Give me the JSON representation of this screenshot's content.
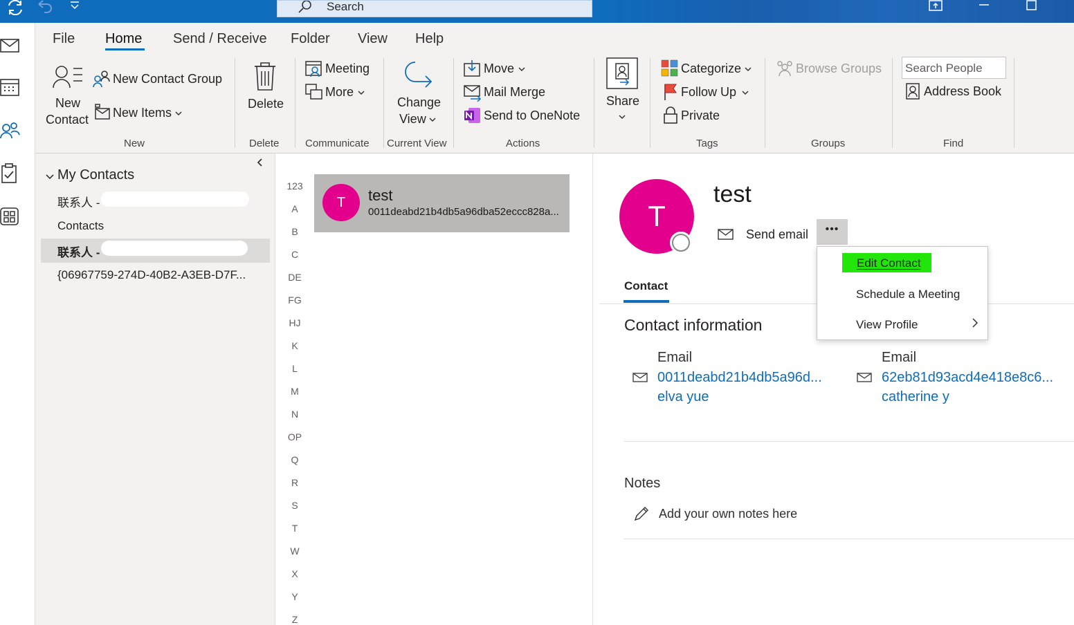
{
  "titlebar": {
    "search_placeholder": "Search"
  },
  "ribbon": {
    "tabs": [
      "File",
      "Home",
      "Send / Receive",
      "Folder",
      "View",
      "Help"
    ],
    "new": {
      "new_contact_line1": "New",
      "new_contact_line2": "Contact",
      "new_contact_group": "New Contact Group",
      "new_items": "New Items",
      "group_label": "New"
    },
    "delete": {
      "label": "Delete",
      "group_label": "Delete"
    },
    "communicate": {
      "meeting": "Meeting",
      "more": "More",
      "group_label": "Communicate"
    },
    "current_view": {
      "line1": "Change",
      "line2": "View",
      "group_label": "Current View"
    },
    "actions": {
      "move": "Move",
      "mail_merge": "Mail Merge",
      "send_to_onenote": "Send to OneNote",
      "group_label": "Actions"
    },
    "share": {
      "label": "Share"
    },
    "tags": {
      "categorize": "Categorize",
      "follow_up": "Follow Up",
      "private": "Private",
      "group_label": "Tags"
    },
    "groups": {
      "browse_groups": "Browse Groups",
      "group_label": "Groups"
    },
    "find": {
      "search_people": "Search People",
      "address_book": "Address Book",
      "group_label": "Find"
    }
  },
  "folders": {
    "header": "My Contacts",
    "items": [
      "联系人 -",
      "Contacts",
      "联系人 -",
      "{06967759-274D-40B2-A3EB-D7F..."
    ]
  },
  "alpha_index": [
    "123",
    "A",
    "B",
    "C",
    "DE",
    "FG",
    "HJ",
    "K",
    "L",
    "M",
    "N",
    "OP",
    "Q",
    "R",
    "S",
    "T",
    "W",
    "X",
    "Y",
    "Z"
  ],
  "contact_list": {
    "selected": {
      "initial": "T",
      "name": "test",
      "email": "0011deabd21b4db5a96dba52eccc828a..."
    }
  },
  "detail": {
    "initial": "T",
    "name": "test",
    "send_email": "Send email",
    "more": "•••",
    "tab_contact": "Contact",
    "section_title": "Contact information",
    "emails": [
      {
        "label": "Email",
        "address": "0011deabd21b4db5a96d...",
        "name": "elva yue"
      },
      {
        "label": "Email",
        "address": "62eb81d93acd4e418e8c6...",
        "name": "catherine y"
      }
    ],
    "notes_title": "Notes",
    "notes_placeholder": "Add your own notes here"
  },
  "menu": {
    "edit_contact": "Edit Contact",
    "schedule_meeting": "Schedule a Meeting",
    "view_profile": "View Profile"
  },
  "colors": {
    "accent": "#0f6cbd",
    "avatar": "#e3008c",
    "highlight": "#22e60a"
  }
}
